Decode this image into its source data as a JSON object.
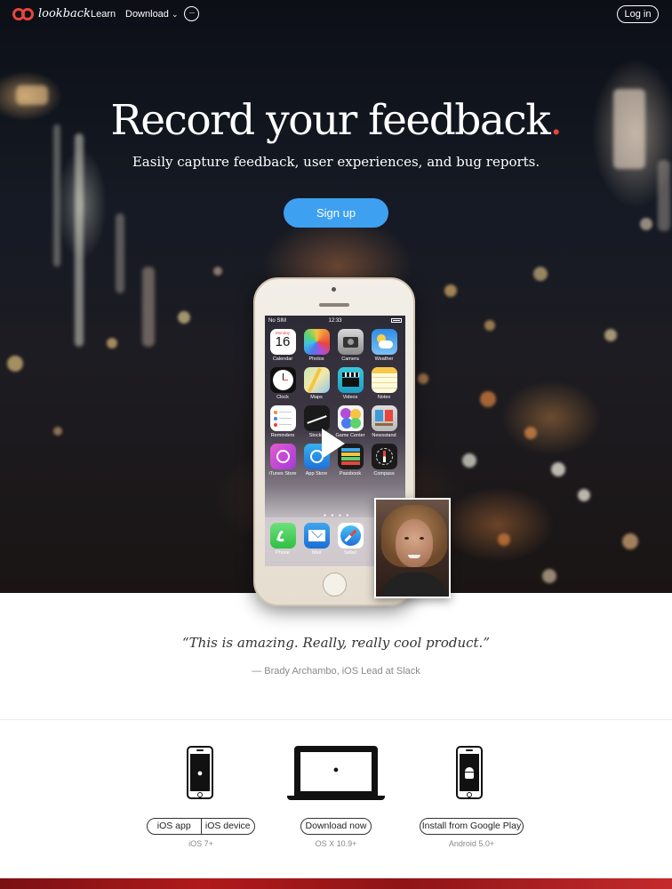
{
  "nav": {
    "logo_text": "lookback",
    "learn": "Learn",
    "download": "Download",
    "download_chevron": "⌄",
    "more": "···",
    "login": "Log in"
  },
  "hero": {
    "title": "Record your feedback",
    "title_dot": ".",
    "subtitle": "Easily capture feedback, user experiences, and bug reports.",
    "signup": "Sign up"
  },
  "phone": {
    "carrier": "No SIM",
    "time": "12:33",
    "calendar_day": "Monday",
    "calendar_date": "16",
    "apps": [
      {
        "label": "Calendar"
      },
      {
        "label": "Photos"
      },
      {
        "label": "Camera"
      },
      {
        "label": "Weather"
      },
      {
        "label": "Clock"
      },
      {
        "label": "Maps"
      },
      {
        "label": "Videos"
      },
      {
        "label": "Notes"
      },
      {
        "label": "Reminders"
      },
      {
        "label": "Stocks"
      },
      {
        "label": "Game Center"
      },
      {
        "label": "Newsstand"
      },
      {
        "label": "iTunes Store"
      },
      {
        "label": "App Store"
      },
      {
        "label": "Passbook"
      },
      {
        "label": "Compass"
      }
    ],
    "dock": [
      {
        "label": "Phone"
      },
      {
        "label": "Mail"
      },
      {
        "label": "Safari"
      }
    ]
  },
  "testimonial": {
    "quote": "“This is amazing. Really, really cool product.”",
    "author": "— Brady Archambo, iOS Lead at Slack"
  },
  "downloads": {
    "ios_app": "iOS app",
    "ios_device": "iOS device",
    "ios_req": "iOS 7+",
    "mac": "Download now",
    "mac_req": "OS X 10.9+",
    "android": "Install from Google Play",
    "android_req": "Android 5.0+"
  },
  "colors": {
    "accent_red": "#e8453c",
    "signup_blue": "#3ea0f0"
  }
}
